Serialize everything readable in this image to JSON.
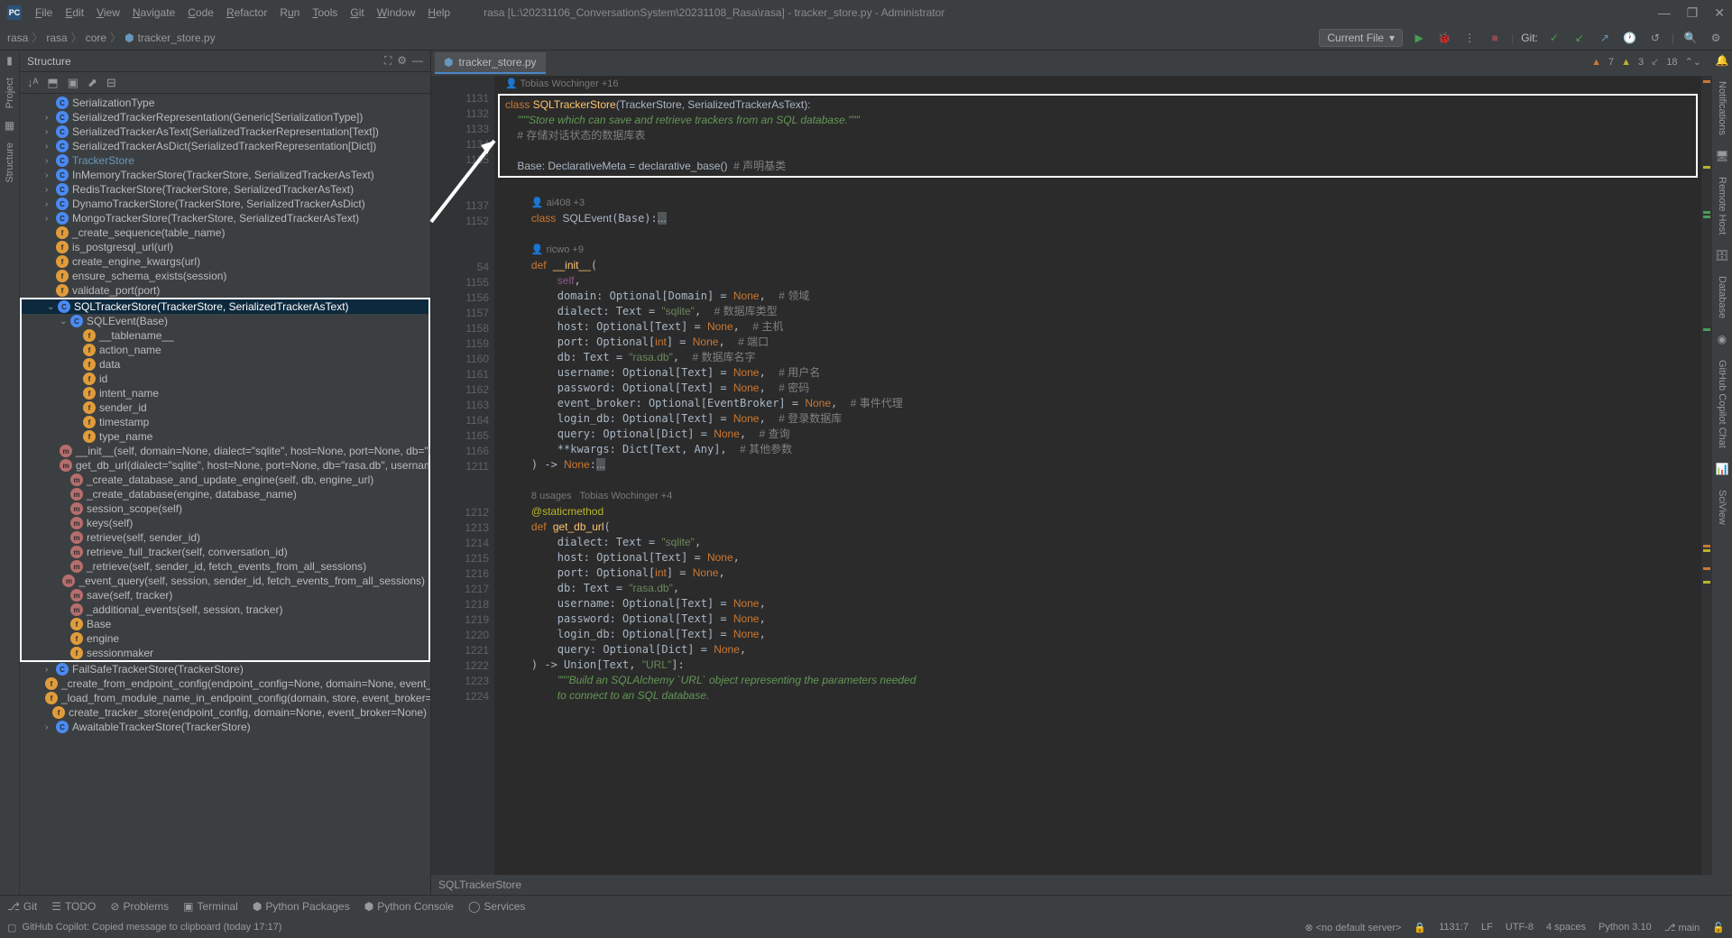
{
  "titlebar": {
    "logo": "PC",
    "menus": [
      "File",
      "Edit",
      "View",
      "Navigate",
      "Code",
      "Refactor",
      "Run",
      "Tools",
      "Git",
      "Window",
      "Help"
    ],
    "title": "rasa [L:\\20231106_ConversationSystem\\20231108_Rasa\\rasa] - tracker_store.py - Administrator"
  },
  "navbar": {
    "breadcrumb": [
      "rasa",
      "rasa",
      "core",
      "tracker_store.py"
    ],
    "config": "Current File",
    "git_label": "Git:"
  },
  "structure": {
    "title": "Structure",
    "items": [
      {
        "d": 2,
        "i": "c",
        "t": "SerializationType",
        "a": ""
      },
      {
        "d": 2,
        "i": "c",
        "t": "SerializedTrackerRepresentation(Generic[SerializationType])",
        "a": ">"
      },
      {
        "d": 2,
        "i": "c",
        "t": "SerializedTrackerAsText(SerializedTrackerRepresentation[Text])",
        "a": ">"
      },
      {
        "d": 2,
        "i": "c",
        "t": "SerializedTrackerAsDict(SerializedTrackerRepresentation[Dict])",
        "a": ">"
      },
      {
        "d": 2,
        "i": "c",
        "t": "TrackerStore",
        "a": ">",
        "hl": true
      },
      {
        "d": 2,
        "i": "c",
        "t": "InMemoryTrackerStore(TrackerStore, SerializedTrackerAsText)",
        "a": ">"
      },
      {
        "d": 2,
        "i": "c",
        "t": "RedisTrackerStore(TrackerStore, SerializedTrackerAsText)",
        "a": ">"
      },
      {
        "d": 2,
        "i": "c",
        "t": "DynamoTrackerStore(TrackerStore, SerializedTrackerAsDict)",
        "a": ">"
      },
      {
        "d": 2,
        "i": "c",
        "t": "MongoTrackerStore(TrackerStore, SerializedTrackerAsText)",
        "a": ">"
      },
      {
        "d": 2,
        "i": "f",
        "t": "_create_sequence(table_name)",
        "a": ""
      },
      {
        "d": 2,
        "i": "f",
        "t": "is_postgresql_url(url)",
        "a": ""
      },
      {
        "d": 2,
        "i": "f",
        "t": "create_engine_kwargs(url)",
        "a": ""
      },
      {
        "d": 2,
        "i": "f",
        "t": "ensure_schema_exists(session)",
        "a": ""
      },
      {
        "d": 2,
        "i": "f",
        "t": "validate_port(port)",
        "a": ""
      }
    ],
    "selected": {
      "d": 2,
      "i": "c",
      "t": "SQLTrackerStore(TrackerStore, SerializedTrackerAsText)",
      "a": "v"
    },
    "children": [
      {
        "d": 3,
        "i": "c",
        "t": "SQLEvent(Base)",
        "a": "v"
      },
      {
        "d": 4,
        "i": "fld",
        "t": "__tablename__",
        "a": ""
      },
      {
        "d": 4,
        "i": "fld",
        "t": "action_name",
        "a": ""
      },
      {
        "d": 4,
        "i": "fld",
        "t": "data",
        "a": ""
      },
      {
        "d": 4,
        "i": "fld",
        "t": "id",
        "a": ""
      },
      {
        "d": 4,
        "i": "fld",
        "t": "intent_name",
        "a": ""
      },
      {
        "d": 4,
        "i": "fld",
        "t": "sender_id",
        "a": ""
      },
      {
        "d": 4,
        "i": "fld",
        "t": "timestamp",
        "a": ""
      },
      {
        "d": 4,
        "i": "fld",
        "t": "type_name",
        "a": ""
      },
      {
        "d": 3,
        "i": "m",
        "t": "__init__(self, domain=None, dialect=\"sqlite\", host=None, port=None, db=\"rasa.db\", usern",
        "a": ""
      },
      {
        "d": 3,
        "i": "m",
        "t": "get_db_url(dialect=\"sqlite\", host=None, port=None, db=\"rasa.db\", username=None, pas",
        "a": ""
      },
      {
        "d": 3,
        "i": "m",
        "t": "_create_database_and_update_engine(self, db, engine_url)",
        "a": ""
      },
      {
        "d": 3,
        "i": "m",
        "t": "_create_database(engine, database_name)",
        "a": ""
      },
      {
        "d": 3,
        "i": "m",
        "t": "session_scope(self)",
        "a": ""
      },
      {
        "d": 3,
        "i": "m",
        "t": "keys(self)",
        "a": ""
      },
      {
        "d": 3,
        "i": "m",
        "t": "retrieve(self, sender_id)",
        "a": ""
      },
      {
        "d": 3,
        "i": "m",
        "t": "retrieve_full_tracker(self, conversation_id)",
        "a": ""
      },
      {
        "d": 3,
        "i": "m",
        "t": "_retrieve(self, sender_id, fetch_events_from_all_sessions)",
        "a": ""
      },
      {
        "d": 3,
        "i": "m",
        "t": "_event_query(self, session, sender_id, fetch_events_from_all_sessions)",
        "a": ""
      },
      {
        "d": 3,
        "i": "m",
        "t": "save(self, tracker)",
        "a": ""
      },
      {
        "d": 3,
        "i": "m",
        "t": "_additional_events(self, session, tracker)",
        "a": ""
      },
      {
        "d": 3,
        "i": "fld",
        "t": "Base",
        "a": ""
      },
      {
        "d": 3,
        "i": "fld",
        "t": "engine",
        "a": ""
      },
      {
        "d": 3,
        "i": "fld",
        "t": "sessionmaker",
        "a": ""
      }
    ],
    "after": [
      {
        "d": 2,
        "i": "c",
        "t": "FailSafeTrackerStore(TrackerStore)",
        "a": ">"
      },
      {
        "d": 2,
        "i": "f",
        "t": "_create_from_endpoint_config(endpoint_config=None, domain=None, event_broker=None)",
        "a": ""
      },
      {
        "d": 2,
        "i": "f",
        "t": "_load_from_module_name_in_endpoint_config(domain, store, event_broker=None)",
        "a": ""
      },
      {
        "d": 2,
        "i": "f",
        "t": "create_tracker_store(endpoint_config, domain=None, event_broker=None)",
        "a": ""
      },
      {
        "d": 2,
        "i": "c",
        "t": "AwaitableTrackerStore(TrackerStore)",
        "a": ">"
      }
    ]
  },
  "editor": {
    "tab": "tracker_store.py",
    "inspection": {
      "errors": "7",
      "warnings": "3",
      "weak": "18"
    },
    "breadcrumb_bottom": "SQLTrackerStore",
    "authors": {
      "a1": "Tobias Wochinger +16",
      "a2": "ai408 +3",
      "a3": "ricwo +9",
      "a4": "8 usages   Tobias Wochinger +4"
    },
    "gutter": [
      "",
      "1131",
      "1132",
      "1133",
      "1134",
      "1135",
      "",
      "",
      "1137",
      "1152",
      "",
      "",
      "54",
      "1155",
      "1156",
      "1157",
      "1158",
      "1159",
      "1160",
      "1161",
      "1162",
      "1163",
      "1164",
      "1165",
      "1166",
      "1211",
      "",
      "",
      "1212",
      "1213",
      "1214",
      "1215",
      "1216",
      "1217",
      "1218",
      "1219",
      "1220",
      "1221",
      "1222",
      "1223",
      "1224"
    ]
  },
  "bottom": {
    "tools": [
      "Git",
      "TODO",
      "Problems",
      "Terminal",
      "Python Packages",
      "Python Console",
      "Services"
    ]
  },
  "status": {
    "msg": "GitHub Copilot: Copied message to clipboard (today 17:17)",
    "server": "<no default server>",
    "caret": "1131:7",
    "eol": "LF",
    "enc": "UTF-8",
    "indent": "4 spaces",
    "python": "Python 3.10",
    "branch": "main"
  },
  "right_rail": [
    "Notifications",
    "Remote Host",
    "Database",
    "GitHub Copilot Chat",
    "SciView"
  ]
}
